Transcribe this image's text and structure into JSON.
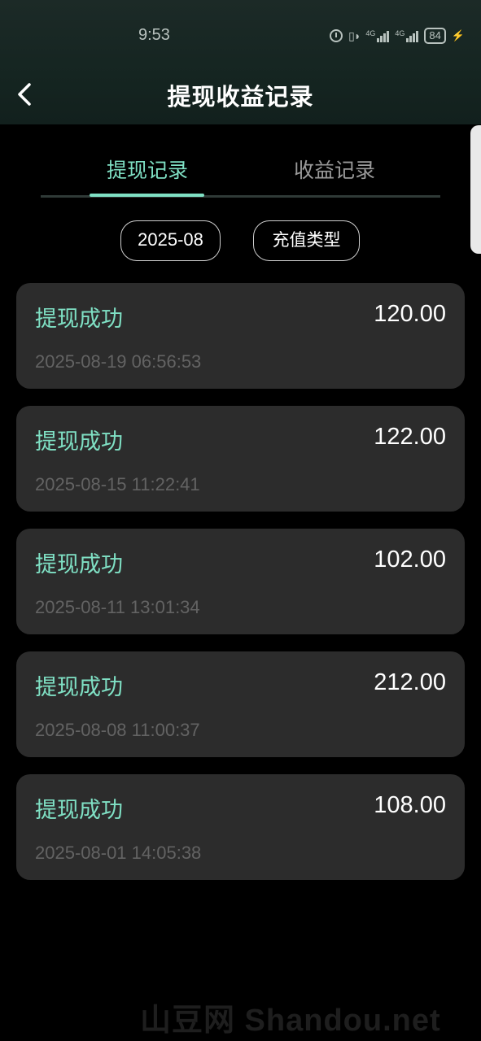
{
  "status_bar": {
    "time": "9:53",
    "battery": "84"
  },
  "header": {
    "title": "提现收益记录"
  },
  "tabs": [
    {
      "label": "提现记录",
      "active": true
    },
    {
      "label": "收益记录",
      "active": false
    }
  ],
  "filters": {
    "date": "2025-08",
    "type": "充值类型"
  },
  "records": [
    {
      "status": "提现成功",
      "amount": "120.00",
      "time": "2025-08-19 06:56:53"
    },
    {
      "status": "提现成功",
      "amount": "122.00",
      "time": "2025-08-15 11:22:41"
    },
    {
      "status": "提现成功",
      "amount": "102.00",
      "time": "2025-08-11 13:01:34"
    },
    {
      "status": "提现成功",
      "amount": "212.00",
      "time": "2025-08-08 11:00:37"
    },
    {
      "status": "提现成功",
      "amount": "108.00",
      "time": "2025-08-01 14:05:38"
    }
  ],
  "watermark": "山豆网 Shandou.net",
  "colors": {
    "accent": "#7fe0c4",
    "card": "#2c2c2c",
    "background": "#000000"
  }
}
